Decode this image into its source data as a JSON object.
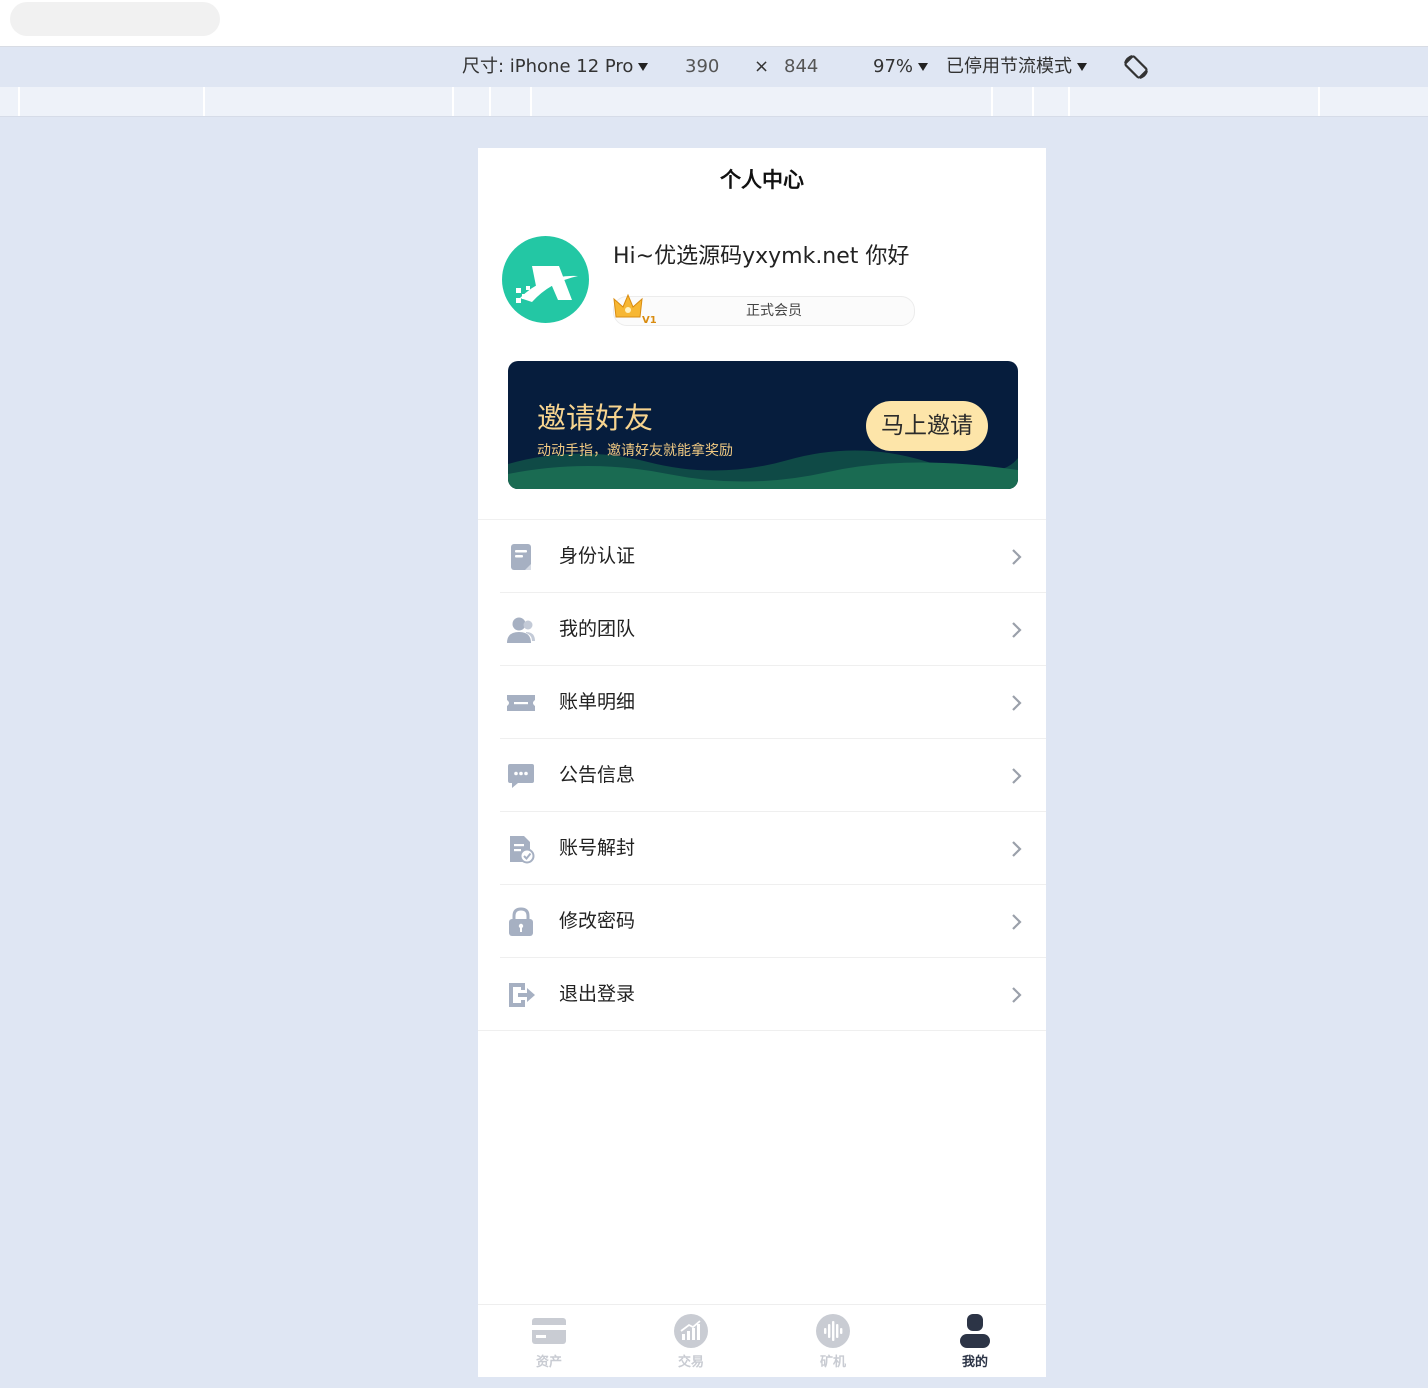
{
  "devtools": {
    "dimensions_label": "尺寸: iPhone 12 Pro",
    "width": "390",
    "times": "×",
    "height": "844",
    "zoom": "97%",
    "throttle": "已停用节流模式"
  },
  "page": {
    "title": "个人中心",
    "greeting": "Hi~优选源码yxymk.net 你好",
    "member_label": "正式会员",
    "vip_level": "V1"
  },
  "banner": {
    "title": "邀请好友",
    "subtitle": "动动手指，邀请好友就能拿奖励",
    "button": "马上邀请"
  },
  "menu": [
    {
      "label": "身份认证",
      "icon": "id-document-icon"
    },
    {
      "label": "我的团队",
      "icon": "team-icon"
    },
    {
      "label": "账单明细",
      "icon": "bill-icon"
    },
    {
      "label": "公告信息",
      "icon": "message-icon"
    },
    {
      "label": "账号解封",
      "icon": "unlock-doc-icon"
    },
    {
      "label": "修改密码",
      "icon": "lock-icon"
    },
    {
      "label": "退出登录",
      "icon": "logout-icon"
    }
  ],
  "tabs": [
    {
      "label": "资产",
      "icon": "card-icon",
      "active": false
    },
    {
      "label": "交易",
      "icon": "chart-icon",
      "active": false
    },
    {
      "label": "矿机",
      "icon": "soundwave-icon",
      "active": false
    },
    {
      "label": "我的",
      "icon": "user-icon",
      "active": true
    }
  ],
  "colors": {
    "accent": "#23c7a4",
    "banner_bg": "#061d3d",
    "banner_text": "#f7d48f",
    "button_bg": "#fde5a9",
    "icon_gray": "#a6b0c2",
    "tab_active": "#2c3446",
    "tab_inactive": "#c9ccd3"
  }
}
